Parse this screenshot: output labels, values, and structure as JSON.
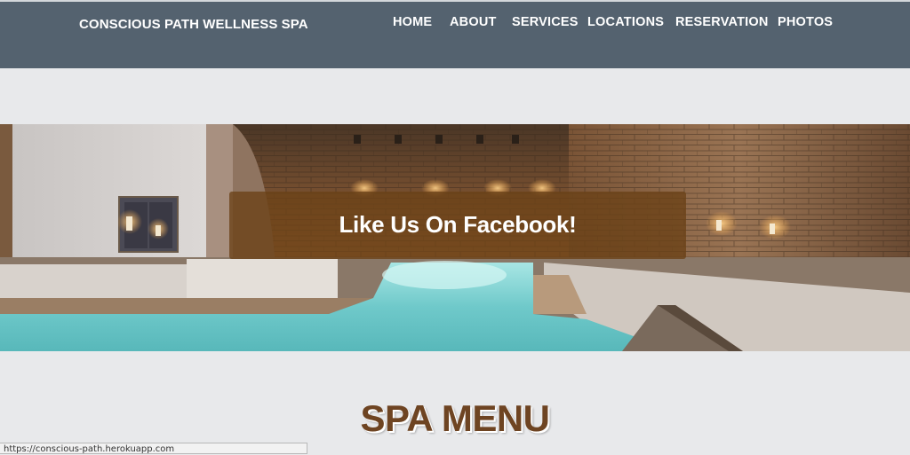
{
  "navbar": {
    "brand": "CONSCIOUS PATH WELLNESS SPA",
    "links": [
      "HOME",
      "ABOUT",
      "SERVICES",
      "LOCATIONS",
      "RESERVATION",
      "PHOTOS"
    ]
  },
  "hero": {
    "banner_text": "Like Us On Facebook!"
  },
  "menu_section": {
    "title": "SPA MENU"
  },
  "status_bar": {
    "url": "https://conscious-path.herokuapp.com"
  },
  "colors": {
    "navbar_bg": "#54626f",
    "page_bg": "#e8e9eb",
    "banner_bg": "#6c4218",
    "title_color": "#6e4422",
    "pool_water": "#7fd3d4"
  }
}
